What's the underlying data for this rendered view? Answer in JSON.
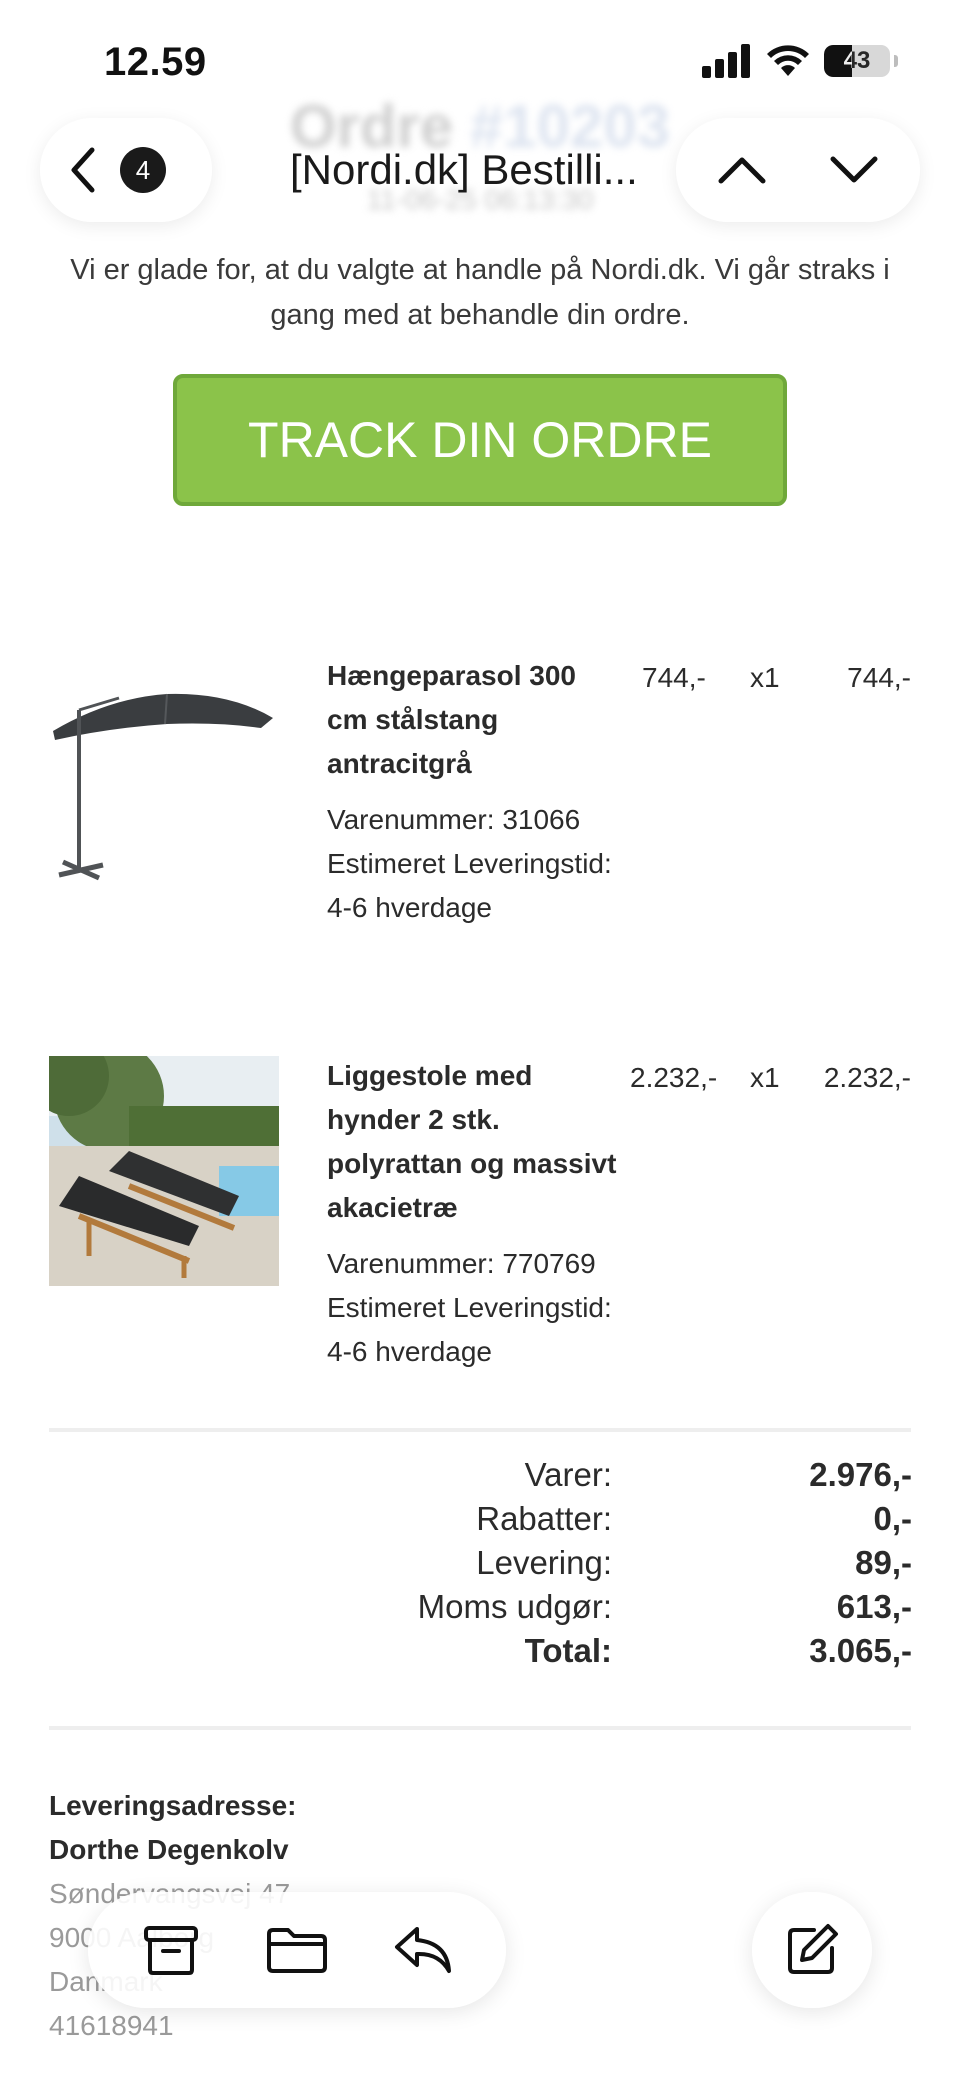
{
  "status_bar": {
    "time": "12.59",
    "battery": "43",
    "battery_level": 0.43
  },
  "background_header": {
    "title_word": "Ordre",
    "order_number": "#10203",
    "datetime": "11-06-25 06:13:30"
  },
  "nav": {
    "unread_count": "4",
    "subject": "[Nordi.dk] Bestilli..."
  },
  "intro_text": "Vi er glade for, at du valgte at handle på Nordi.dk. Vi går straks i gang med at behandle din ordre.",
  "track_button": {
    "label": "TRACK DIN ORDRE",
    "color": "#8bc34a"
  },
  "products": [
    {
      "name": "Hængeparasol 300 cm stålstang antracitgrå",
      "unit_price": "744,-",
      "qty": "x1",
      "line_total": "744,-",
      "sku_label": "Varenummer: 31066",
      "delivery_label": "Estimeret Leveringstid:",
      "delivery_time": "4-6 hverdage"
    },
    {
      "name": "Liggestole med hynder 2 stk. polyrattan og massivt akacietræ",
      "unit_price": "2.232,-",
      "qty": "x1",
      "line_total": "2.232,-",
      "sku_label": "Varenummer: 770769",
      "delivery_label": "Estimeret Leveringstid:",
      "delivery_time": "4-6 hverdage"
    }
  ],
  "totals": [
    {
      "label": "Varer:",
      "value": "2.976,-"
    },
    {
      "label": "Rabatter:",
      "value": "0,-"
    },
    {
      "label": "Levering:",
      "value": "89,-"
    },
    {
      "label": "Moms udgør:",
      "value": "613,-"
    },
    {
      "label": "Total:",
      "value": "3.065,-"
    }
  ],
  "address": {
    "heading": "Leveringsadresse:",
    "name": "Dorthe Degenkolv",
    "street": "Søndervangsvej 47",
    "city": "9000 Aalborg",
    "country": "Danmark",
    "phone": "41618941"
  },
  "toolbar": {
    "icons": [
      "archive-icon",
      "folder-icon",
      "reply-icon",
      "compose-icon"
    ]
  }
}
